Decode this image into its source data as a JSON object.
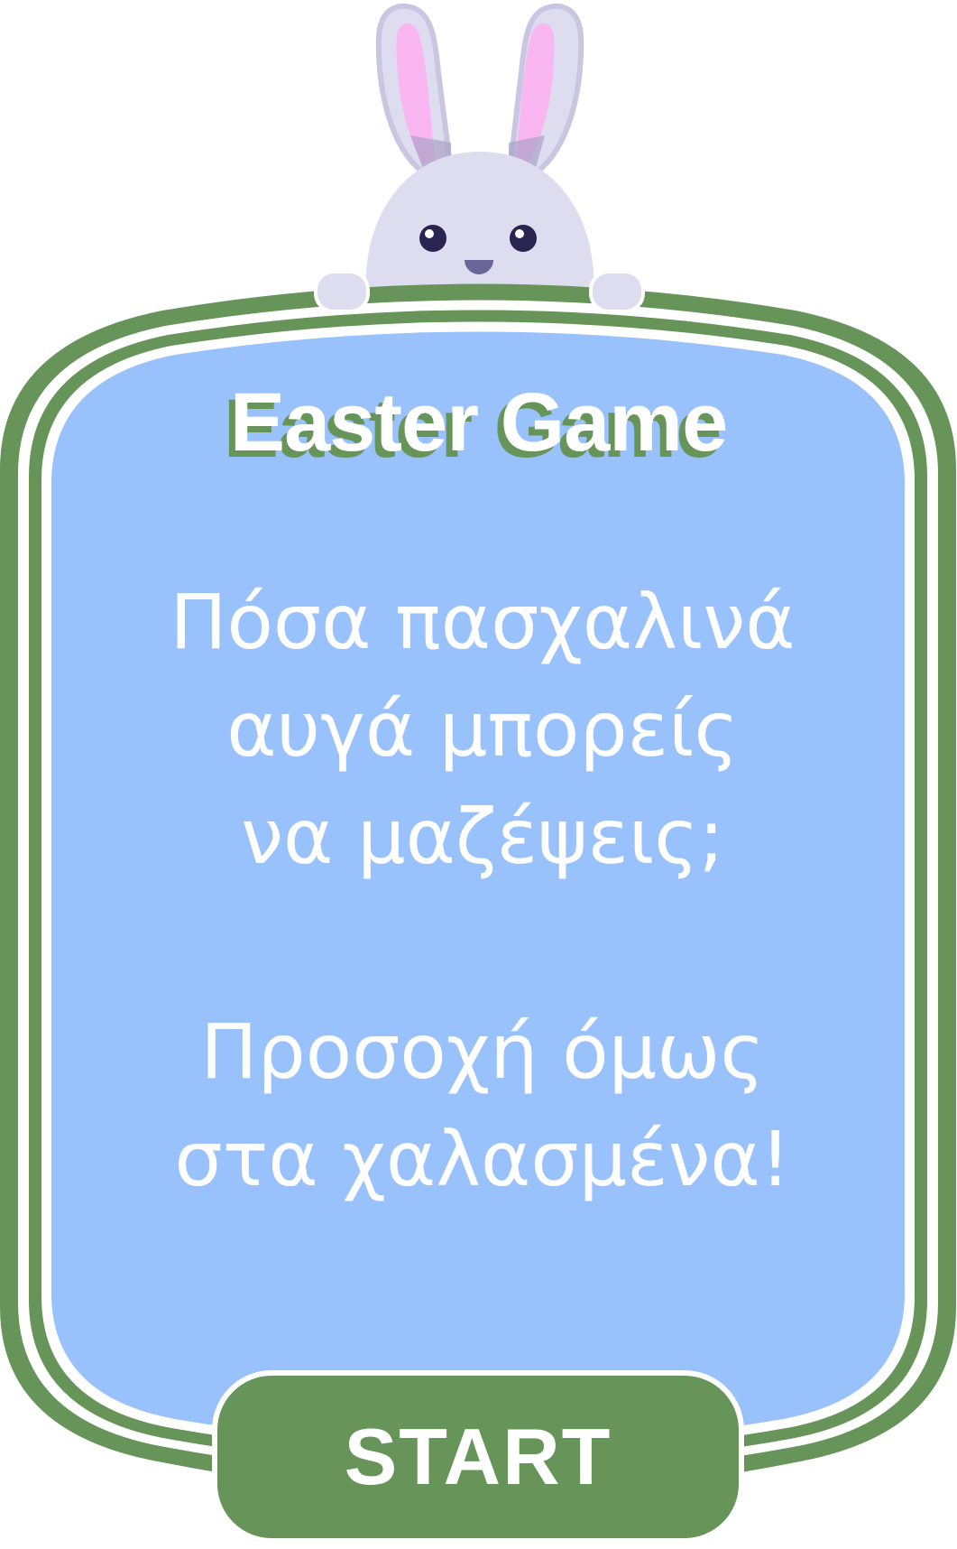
{
  "game": {
    "title": "Easter Game",
    "message": "Πόσα πασχαλινά\nαυγά μπορείς\nνα μαζέψεις;\n\nΠροσοχή όμως\nστα χαλασμένα!",
    "start_label": "START"
  },
  "mascot": {
    "icon": "bunny-icon"
  },
  "colors": {
    "frame_green": "#679459",
    "panel_blue": "#99C1FC",
    "bunny_body": "#DEDCEF",
    "bunny_ear_inner": "#FAB6F0",
    "text_white": "#FFFFFF"
  }
}
